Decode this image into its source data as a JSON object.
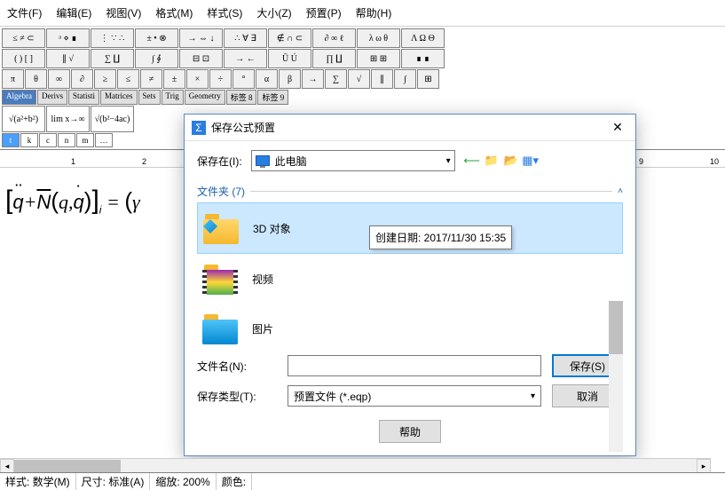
{
  "menu": [
    "文件(F)",
    "编辑(E)",
    "视图(V)",
    "格式(M)",
    "样式(S)",
    "大小(Z)",
    "预置(P)",
    "帮助(H)"
  ],
  "palette": {
    "row1": [
      "≤ ≠ ⊂",
      "ᵃ ⋄ ∎",
      "⋮ ∵ ∴",
      "± • ⊗",
      "→ ⇔ ↓",
      "∴ ∀ ∃",
      "∉ ∩ ⊂",
      "∂ ∞ ℓ",
      "λ ω θ",
      "Λ Ω Θ"
    ],
    "row2": [
      "( ) [ ]",
      "∥ √",
      "∑ ∐",
      "∫ ∮",
      "⊟ ⊡",
      "→ ←",
      "Ū Ú",
      "∏ ∐",
      "⊞ ⊞",
      "∎ ∎"
    ],
    "row3": [
      "π",
      "θ",
      "∞",
      "∂",
      "≥",
      "≤",
      "≠",
      "±",
      "×",
      "÷",
      "°",
      "α",
      "β",
      "→",
      "∑",
      "√",
      "∥",
      "∫",
      "⊞"
    ],
    "tabs": [
      "Algebra",
      "Derivs",
      "Statisti",
      "Matrices",
      "Sets",
      "Trig",
      "Geometry",
      "标签 8",
      "标签 9"
    ],
    "templates": [
      "√(a²+b²)",
      "lim x→∞",
      "√(b²−4ac)"
    ],
    "mini": [
      "t",
      "k",
      "c",
      "n",
      "m",
      "…"
    ]
  },
  "ruler_marks": [
    "1",
    "2",
    "9",
    "10"
  ],
  "equation": {
    "raw": "[q̈ + N̄(q, q̇)]ᵢ = (γ"
  },
  "dialog": {
    "title": "保存公式预置",
    "save_in_label": "保存在(I):",
    "location": "此电脑",
    "group_header": "文件夹 (7)",
    "items": [
      {
        "name": "3D 对象",
        "kind": "3d"
      },
      {
        "name": "视频",
        "kind": "video"
      },
      {
        "name": "图片",
        "kind": "pictures"
      }
    ],
    "tooltip": "创建日期: 2017/11/30 15:35",
    "filename_label": "文件名(N):",
    "filename_value": "",
    "filetype_label": "保存类型(T):",
    "filetype_value": "预置文件 (*.eqp)",
    "save_btn": "保存(S)",
    "cancel_btn": "取消",
    "help_btn": "帮助"
  },
  "status": {
    "style": "样式: 数学(M)",
    "size": "尺寸: 标准(A)",
    "zoom": "缩放: 200%",
    "color": "颜色:"
  }
}
